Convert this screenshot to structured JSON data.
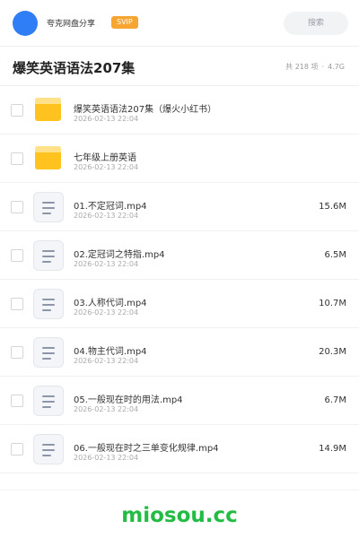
{
  "header": {
    "site_name": "夸克网盘分享",
    "badge": "SVIP",
    "search_placeholder": "搜索"
  },
  "page": {
    "title": "爆笑英语语法207集",
    "count": "共 218 项",
    "separator": "·",
    "total_size": "4.7G"
  },
  "files": [
    {
      "type": "folder",
      "name": "爆笑英语语法207集（爆火小红书）",
      "date": "2026-02-13 22:04",
      "size": ""
    },
    {
      "type": "folder",
      "name": "七年级上册英语",
      "date": "2026-02-13 22:04",
      "size": ""
    },
    {
      "type": "file",
      "name": "01.不定冠词.mp4",
      "date": "2026-02-13 22:04",
      "size": "15.6M"
    },
    {
      "type": "file",
      "name": "02.定冠词之特指.mp4",
      "date": "2026-02-13 22:04",
      "size": "6.5M"
    },
    {
      "type": "file",
      "name": "03.人称代词.mp4",
      "date": "2026-02-13 22:04",
      "size": "10.7M"
    },
    {
      "type": "file",
      "name": "04.物主代词.mp4",
      "date": "2026-02-13 22:04",
      "size": "20.3M"
    },
    {
      "type": "file",
      "name": "05.一般现在时的用法.mp4",
      "date": "2026-02-13 22:04",
      "size": "6.7M"
    },
    {
      "type": "file",
      "name": "06.一般现在时之三单变化规律.mp4",
      "date": "2026-02-13 22:04",
      "size": "14.9M"
    }
  ],
  "footer": {
    "brand": "miosou.cc"
  },
  "colors": {
    "avatar": "#2f7ef5",
    "badge": "#f7a531",
    "folder": "#ffc21e",
    "brand": "#22bb44"
  }
}
